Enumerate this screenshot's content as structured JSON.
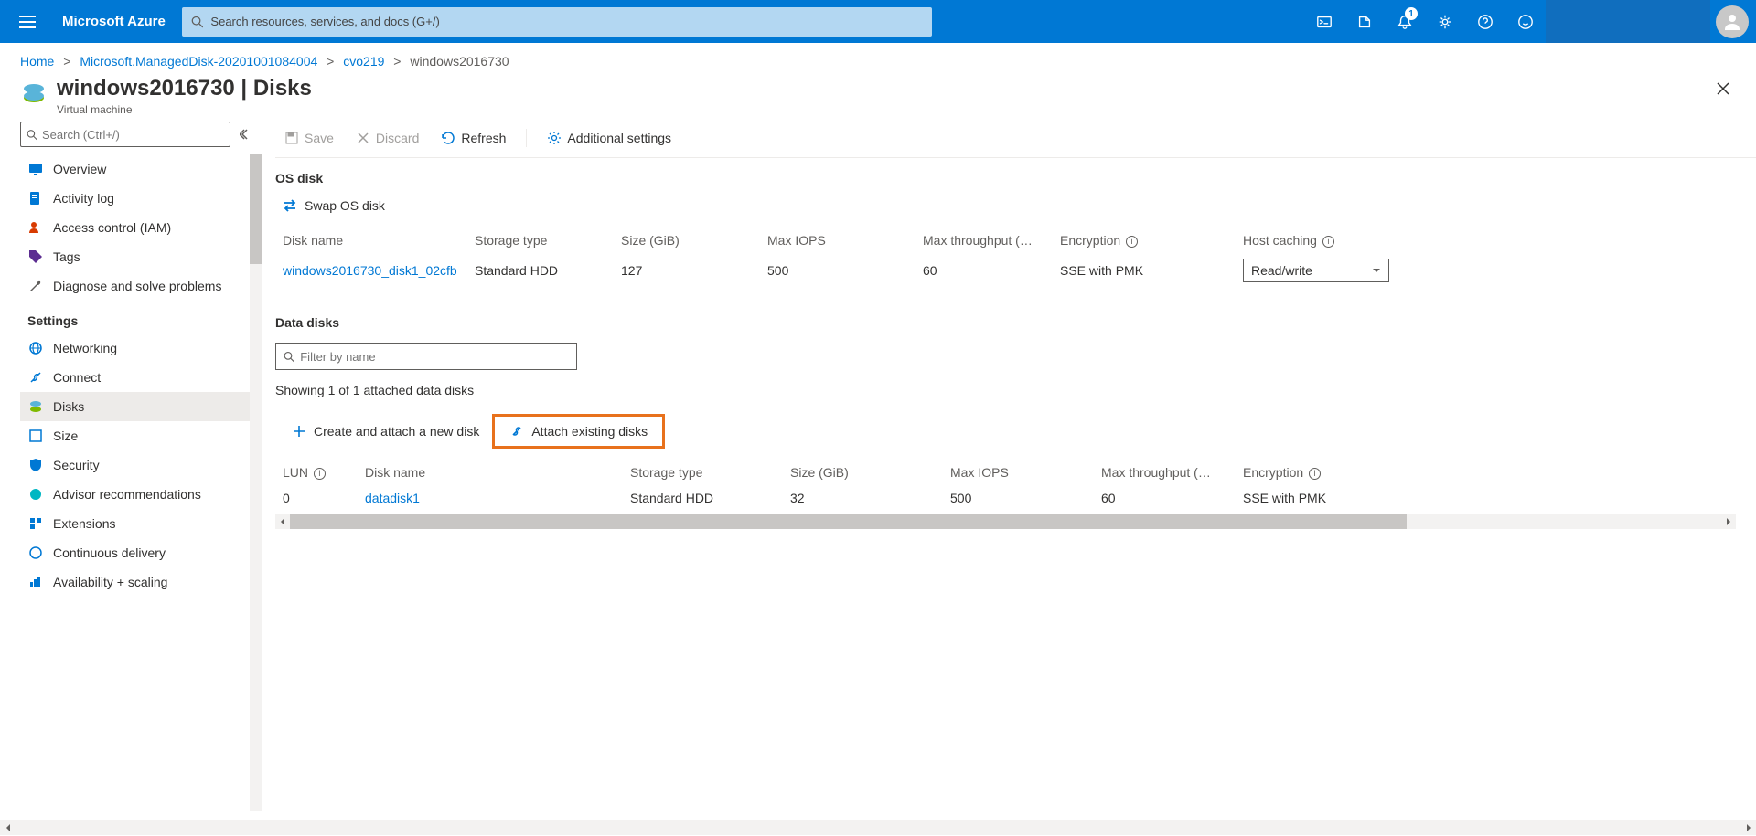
{
  "header": {
    "brand": "Microsoft Azure",
    "search_placeholder": "Search resources, services, and docs (G+/)",
    "notif_count": "1"
  },
  "breadcrumb": {
    "home": "Home",
    "b1": "Microsoft.ManagedDisk-20201001084004",
    "b2": "cvo219",
    "current": "windows2016730"
  },
  "page": {
    "title": "windows2016730 | Disks",
    "subtitle": "Virtual machine"
  },
  "sidebar": {
    "search_placeholder": "Search (Ctrl+/)",
    "items_top": [
      {
        "label": "Overview"
      },
      {
        "label": "Activity log"
      },
      {
        "label": "Access control (IAM)"
      },
      {
        "label": "Tags"
      },
      {
        "label": "Diagnose and solve problems"
      }
    ],
    "settings_heading": "Settings",
    "items_settings": [
      {
        "label": "Networking"
      },
      {
        "label": "Connect"
      },
      {
        "label": "Disks"
      },
      {
        "label": "Size"
      },
      {
        "label": "Security"
      },
      {
        "label": "Advisor recommendations"
      },
      {
        "label": "Extensions"
      },
      {
        "label": "Continuous delivery"
      },
      {
        "label": "Availability + scaling"
      }
    ]
  },
  "toolbar": {
    "save": "Save",
    "discard": "Discard",
    "refresh": "Refresh",
    "additional": "Additional settings"
  },
  "os_disk": {
    "title": "OS disk",
    "swap": "Swap OS disk",
    "headers": {
      "name": "Disk name",
      "storage": "Storage type",
      "size": "Size (GiB)",
      "iops": "Max IOPS",
      "throughput": "Max throughput (…",
      "enc": "Encryption",
      "host": "Host caching"
    },
    "row": {
      "name": "windows2016730_disk1_02cfb",
      "storage": "Standard HDD",
      "size": "127",
      "iops": "500",
      "throughput": "60",
      "enc": "SSE with PMK",
      "host": "Read/write"
    }
  },
  "data_disks": {
    "title": "Data disks",
    "filter_placeholder": "Filter by name",
    "showing": "Showing 1 of 1 attached data disks",
    "create": "Create and attach a new disk",
    "attach": "Attach existing disks",
    "headers": {
      "lun": "LUN",
      "name": "Disk name",
      "storage": "Storage type",
      "size": "Size (GiB)",
      "iops": "Max IOPS",
      "throughput": "Max throughput (…",
      "enc": "Encryption"
    },
    "row": {
      "lun": "0",
      "name": "datadisk1",
      "storage": "Standard HDD",
      "size": "32",
      "iops": "500",
      "throughput": "60",
      "enc": "SSE with PMK"
    }
  }
}
